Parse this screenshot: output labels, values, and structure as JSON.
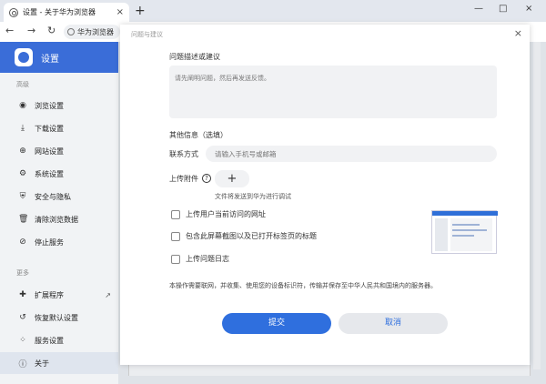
{
  "browser": {
    "tab_title": "设置 - 关于华为浏览器",
    "tab_close": "×",
    "new_tab": "+",
    "window_controls": [
      "—",
      "□",
      "×"
    ],
    "nav": [
      "←",
      "→",
      "↻"
    ],
    "address_text": "华为浏览器"
  },
  "sidebar": {
    "brand": "设置",
    "section_advanced": "高级",
    "section_more": "更多",
    "items_advanced": [
      {
        "icon": "eye-icon",
        "glyph": "◉",
        "label": "浏览设置"
      },
      {
        "icon": "download-icon",
        "glyph": "⤓",
        "label": "下载设置"
      },
      {
        "icon": "globe-icon",
        "glyph": "⊕",
        "label": "网站设置"
      },
      {
        "icon": "gear-icon",
        "glyph": "⚙",
        "label": "系统设置"
      },
      {
        "icon": "shield-icon",
        "glyph": "⛨",
        "label": "安全与隐私"
      },
      {
        "icon": "trash-icon",
        "glyph": "🗑",
        "label": "清除浏览数据"
      },
      {
        "icon": "stop-icon",
        "glyph": "⊘",
        "label": "停止服务"
      }
    ],
    "items_more": [
      {
        "icon": "puzzle-icon",
        "glyph": "✚",
        "label": "扩展程序"
      },
      {
        "icon": "restore-icon",
        "glyph": "↺",
        "label": "恢复默认设置"
      },
      {
        "icon": "services-icon",
        "glyph": "⁘",
        "label": "服务设置"
      },
      {
        "icon": "info-icon",
        "glyph": "ⓘ",
        "label": "关于"
      }
    ],
    "external_glyph": "↗"
  },
  "dialog": {
    "title": "问题与建议",
    "close": "×",
    "description_label": "问题描述或建议",
    "description_placeholder": "请先阐明问题，然后再发送反馈。",
    "other_info_label": "其他信息（选填）",
    "contact_label": "联系方式",
    "contact_placeholder": "请输入手机号或邮箱",
    "upload_label": "上传附件",
    "help_glyph": "?",
    "upload_glyph": "+",
    "upload_hint": "文件将发送到华为进行调试",
    "checkbox_1": "上传用户当前访问的网址",
    "checkbox_2": "包含此屏幕截图以及已打开标签页的标题",
    "checkbox_3": "上传问题日志",
    "notice": "本操作需要联网，并收集、使用您的设备标识符，传输并保存至中华人民共和国境内的服务器。",
    "submit": "提交",
    "cancel": "取消"
  }
}
